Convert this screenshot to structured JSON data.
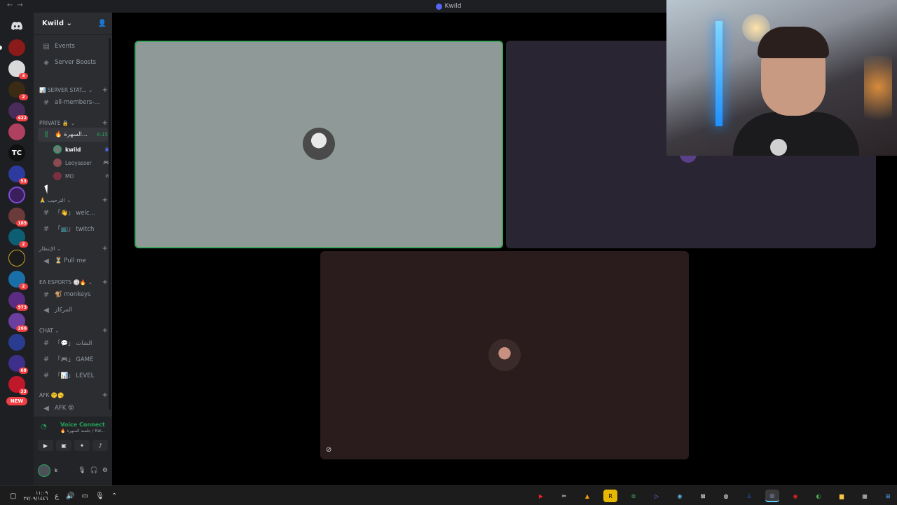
{
  "window": {
    "title": "Kwild"
  },
  "guild": {
    "name": "Kwild"
  },
  "sidebar": {
    "top_items": [
      {
        "label": "Events",
        "icon": "calendar-icon"
      },
      {
        "label": "Server Boosts",
        "icon": "boost-icon"
      }
    ],
    "categories": {
      "server_stats": "SERVER STAT...",
      "private": "Private 🔒",
      "welcome": "🙏 الترحيب",
      "waiting": "الإنتظار",
      "ea_esports": "EA ESPORTS 🏐🔥",
      "chat": "CHAT",
      "afk": "AFK 😵‍💫🥱"
    },
    "channels": {
      "all_members": "all-members-...",
      "voice_private": "🔥 السهرة...",
      "voice_private_timer": "6:15",
      "welcome_ch": "「👋」 welc...",
      "twitch_ch": "「📺」 twitch",
      "pull_me": "⏳ Pull me",
      "monkeys": "🐒 monkeys",
      "markaz": "المركاز",
      "chat_ch": "「💬」 الشات",
      "game_ch": "「🎮」 GAME",
      "level_ch": "「📊」 LEVEL",
      "afk_ch": "AFK 😵"
    },
    "voice_users": [
      {
        "name": "kwild",
        "self": true
      },
      {
        "name": "Leoyasser",
        "self": false
      },
      {
        "name": "MO",
        "self": false
      }
    ]
  },
  "rail": {
    "badges": [
      "3",
      "2",
      "422",
      "",
      "",
      "53",
      "",
      "185",
      "2",
      "",
      "2",
      "973",
      "266",
      "",
      "68",
      "33"
    ],
    "new_label": "NEW"
  },
  "voice_panel": {
    "status": "Voice Connect",
    "channel": "🔥 جلسة السهرة / Kw..."
  },
  "user_panel": {
    "name": "k"
  },
  "taskbar": {
    "time": "١١:٠٩",
    "date": "٢٧/٠٩/١٤٤٦",
    "lang": "ع"
  },
  "colors": {
    "speaking_border": "#3ba55d",
    "tile_1": "#8f9a98",
    "tile_2": "#2a2532",
    "tile_3": "#2a1b1c",
    "accent": "#5865f2"
  }
}
